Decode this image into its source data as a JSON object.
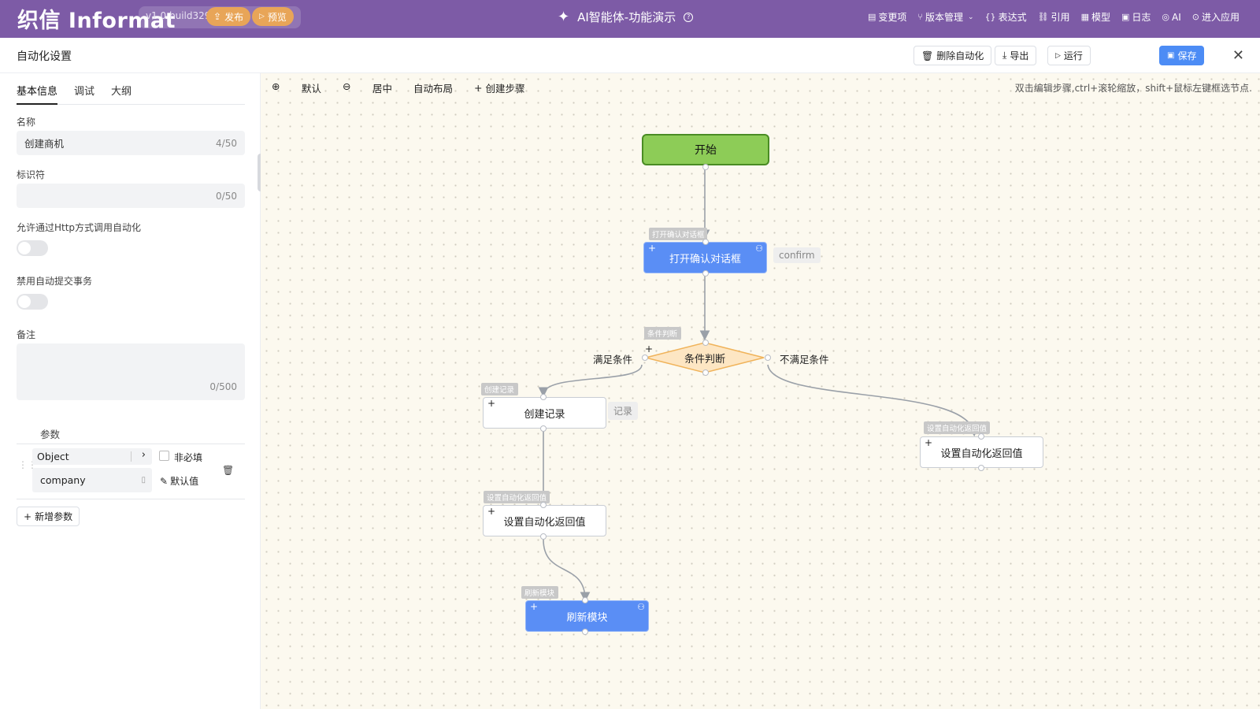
{
  "topbar": {
    "logo": "织信 Informat",
    "version": "v1.0 build329",
    "publish": "发布",
    "preview": "预览",
    "app_title": "AI智能体-功能演示",
    "nav": [
      {
        "label": "变更项",
        "icon": "list-icon"
      },
      {
        "label": "版本管理",
        "icon": "branch-icon"
      },
      {
        "label": "表达式",
        "icon": "braces-icon"
      },
      {
        "label": "引用",
        "icon": "link-icon"
      },
      {
        "label": "模型",
        "icon": "table-icon"
      },
      {
        "label": "日志",
        "icon": "log-icon"
      },
      {
        "label": "AI",
        "icon": "ai-icon"
      },
      {
        "label": "进入应用",
        "icon": "enter-icon"
      }
    ]
  },
  "header": {
    "title": "自动化设置",
    "delete": "删除自动化",
    "export": "导出",
    "run": "运行",
    "save": "保存"
  },
  "left": {
    "tabs": [
      "基本信息",
      "调试",
      "大纲"
    ],
    "name_label": "名称",
    "name_value": "创建商机",
    "name_count": "4/50",
    "id_label": "标识符",
    "id_value": "",
    "id_count": "0/50",
    "http_label": "允许通过Http方式调用自动化",
    "http_enabled": false,
    "autocommit_label": "禁用自动提交事务",
    "autocommit_disabled": false,
    "remark_label": "备注",
    "remark_count": "0/500",
    "params_title": "参数",
    "param": {
      "type": "Object",
      "optional_label": "非必填",
      "name": "company",
      "default_label": "默认值"
    },
    "add_param": "新增参数"
  },
  "canvas": {
    "toolbar": {
      "default": "默认",
      "center": "居中",
      "auto_layout": "自动布局",
      "create_step": "创建步骤"
    },
    "hint": "双击编辑步骤,ctrl+滚轮缩放，shift+鼠标左键框选节点.",
    "nodes": {
      "start": "开始",
      "confirm": {
        "label": "打开确认对话框",
        "tag": "打开确认对话框",
        "side": "confirm"
      },
      "condition": {
        "label": "条件判断",
        "tag": "条件判断",
        "yes": "满足条件",
        "no": "不满足条件"
      },
      "create": {
        "label": "创建记录",
        "tag": "创建记录",
        "side": "记录"
      },
      "ret_right": {
        "label": "设置自动化返回值",
        "tag": "设置自动化返回值"
      },
      "ret_left": {
        "label": "设置自动化返回值",
        "tag": "设置自动化返回值"
      },
      "refresh": {
        "label": "刷新模块",
        "tag": "刷新模块"
      }
    }
  }
}
